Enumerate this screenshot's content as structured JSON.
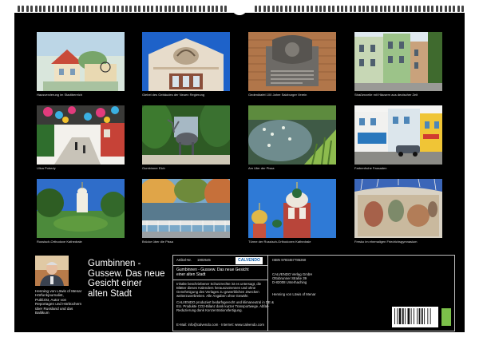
{
  "photos": [
    {
      "caption": "Hausverzierung im Stadtbereich"
    },
    {
      "caption": "Giebel des Gebäudes der Neuen Regierung"
    },
    {
      "caption": "Gedenktafel 100 Jahre Salzburger Verein"
    },
    {
      "caption": "Straßenzeile mit Häusern aus deutscher Zeit"
    },
    {
      "caption": "Ulica Pobedy"
    },
    {
      "caption": "Gumbinner Elch"
    },
    {
      "caption": "Am Ufer der Pissa"
    },
    {
      "caption": "Farbenfrohe Fassaden"
    },
    {
      "caption": "Russisch-Orthodoxe Kathedrale"
    },
    {
      "caption": "Brücke über die Pissa"
    },
    {
      "caption": "Türme der Russisch-Orthodoxen Kathedrale"
    },
    {
      "caption": "Fresko im ehemaligen Friedrichsgymnasium"
    }
  ],
  "author": {
    "lines": [
      "Henning von Löwis of Menar",
      "Hörfunkjournalist,",
      "Publizist, Autor von",
      "Reportagen und Hörbüchern",
      "über Russland und das",
      "Baltikum"
    ]
  },
  "title_lines": [
    "Gumbinnen -",
    "Gussew. Das neue",
    "Gesicht einer",
    "alten Stadt"
  ],
  "info": {
    "article_label": "Artikel-Nr.",
    "article_no": "1902545",
    "logo": "CALVENDO",
    "short_title_lines": [
      "Gumbinnen - Gussew. Das neue Gesicht",
      "einer alten Stadt"
    ],
    "legal_lines": [
      "Inhalte beschriebener Schutzrechte ist es untersagt, die",
      "Blätter dieses Kalenders herauszutrennen und ohne",
      "Genehmigung des Verlages zu gewerblichen Zwecken",
      "weiterzuverbreiten. Alle Angaben ohne Gewähr."
    ],
    "eco_lines": [
      "CALVENDO produziert bedarfsgerecht und klimaneutral in DE &",
      "EU. Produkte CO2-Bilanz dank kurzer Transportwege. Abfall-",
      "Reduzierung dank Konzentrationsfertigung."
    ],
    "contact": "E-Mail: info@calvendo.com · Internet: www.calvendo.com",
    "isbn": "ISBN 9783457786260",
    "publisher_lines": [
      "CALVENDO Verlag GmbH",
      "Ottobrunner Straße 39",
      "D-82008 Unterhaching"
    ],
    "copyright": "Henning von Löwis of Menar"
  },
  "colors": {
    "background": "#000000",
    "caption": "#dddddd",
    "accent": "#0b5aa6"
  }
}
